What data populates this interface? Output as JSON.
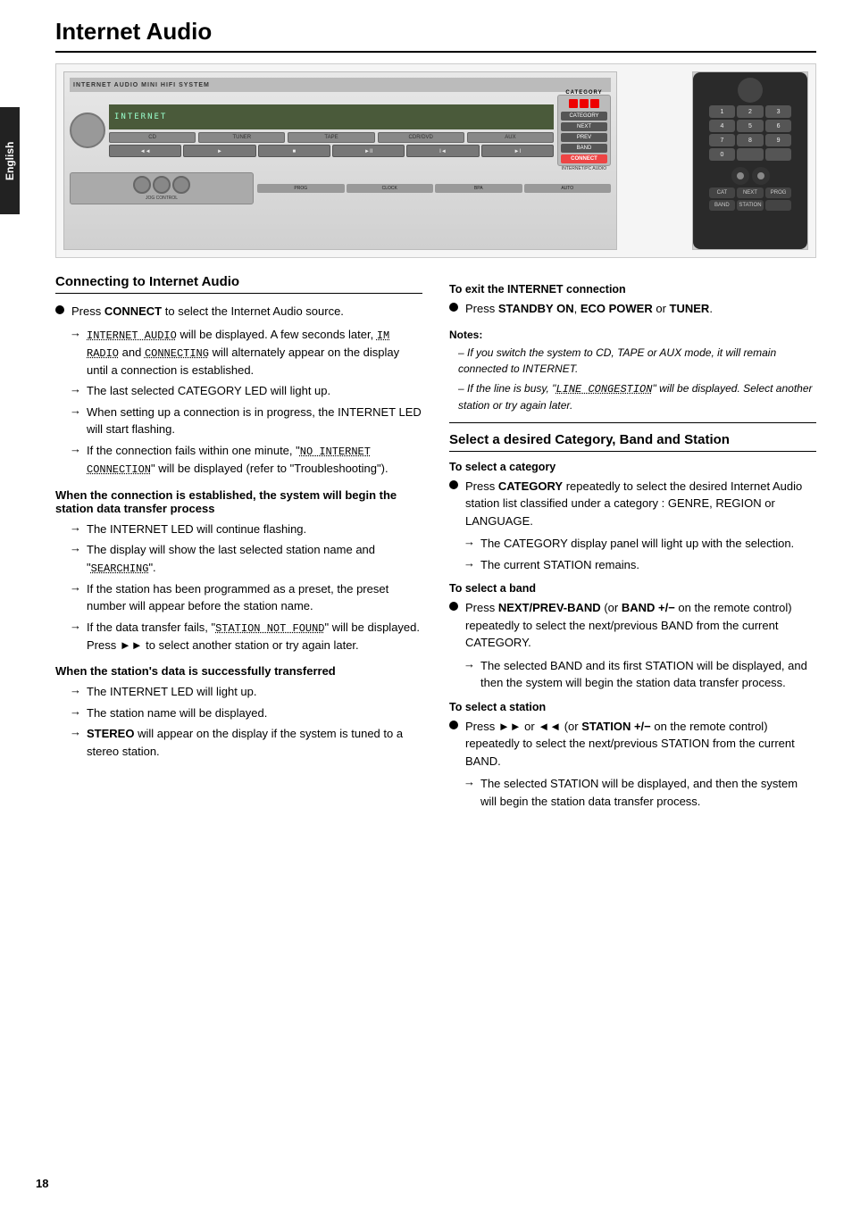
{
  "page": {
    "title": "Internet Audio",
    "number": "18",
    "language_label": "English"
  },
  "device_image": {
    "alt_main": "Internet Audio Mini HiFi System front panel",
    "alt_remote": "Remote control"
  },
  "connecting_section": {
    "heading": "Connecting to Internet Audio",
    "bullet1": {
      "text_before": "Press ",
      "bold": "CONNECT",
      "text_after": " to select the Internet Audio source."
    },
    "arrow1": "\"INTERNET AUDIO\" will be displayed. A few seconds later, \"IM RADIO\" and \"CONNECTING\" will alternately appear on the display until a connection is established.",
    "arrow2": "The last selected CATEGORY LED will light up.",
    "arrow3": "When setting up a connection is in progress, the INTERNET LED will start flashing.",
    "arrow4": "If the connection fails within one minute, \"NO INTERNET CONNECTION\" will be displayed (refer to \"Troubleshooting\").",
    "subhead1": "When the connection is established, the system will begin the station data transfer process",
    "sub_arrow1": "The INTERNET LED will continue flashing.",
    "sub_arrow2": "The display will show the last selected station name and \"SEARCHING\".",
    "sub_arrow3": "If the station has been programmed as a preset, the preset number will appear before the station name.",
    "sub_arrow4": "If the data transfer fails, \"STATION NOT FOUND\" will be displayed. Press ►► to select another station or try again later.",
    "subhead2": "When the station's data is successfully transferred",
    "sub2_arrow1": "The INTERNET LED will light up.",
    "sub2_arrow2": "The station name will be displayed.",
    "sub2_arrow3": "STEREO will appear on the display if the system is tuned to a stereo station."
  },
  "exit_section": {
    "heading": "To exit the INTERNET connection",
    "bullet1_before": "Press ",
    "bullet1_bold1": "STANDBY ON",
    "bullet1_sep": ", ",
    "bullet1_bold2": "ECO POWER",
    "bullet1_or": " or ",
    "bullet1_bold3": "TUNER",
    "bullet1_dot": ".",
    "notes_label": "Notes:",
    "note1": "If you switch the system to CD, TAPE or AUX mode, it will remain connected to INTERNET.",
    "note2": "If the line is busy, \"LINE CONGESTION\" will be displayed. Select another station or try again later."
  },
  "select_section": {
    "heading": "Select a desired Category, Band and Station",
    "category_subhead": "To select a category",
    "category_bullet_before": "Press ",
    "category_bullet_bold": "CATEGORY",
    "category_bullet_after": " repeatedly to select the desired Internet Audio station list classified under a category : GENRE, REGION or LANGUAGE.",
    "category_arrow1": "The CATEGORY display panel will light up with the selection.",
    "category_arrow2": "The current STATION remains.",
    "band_subhead": "To select a band",
    "band_bullet_before": "Press ",
    "band_bullet_bold": "NEXT/PREV-BAND",
    "band_bullet_middle": " (or ",
    "band_bullet_bold2": "BAND +/−",
    "band_bullet_after": " on the remote control) repeatedly to select the next/previous BAND from the current CATEGORY.",
    "band_arrow1": "The selected BAND and its first STATION will be displayed, and then the system will begin the station data transfer process.",
    "station_subhead": "To select a station",
    "station_bullet_before": "Press ►► or ◄◄ (or ",
    "station_bullet_bold": "STATION +/−",
    "station_bullet_after": " on the remote control) repeatedly to select the next/previous STATION from the current BAND.",
    "station_arrow1": "The selected STATION will be displayed, and then the system will begin the station data transfer process."
  },
  "display": {
    "internet_audio": "INTERNET AUDIO",
    "im_radio": "IM RADIO",
    "connecting": "CONNECTING",
    "searching": "SEARCHING",
    "station_not_found": "STATION NOT FOUND",
    "no_internet_connection": "NO INTERNET CONNECTION",
    "line_congestion": "LINE CONGESTION"
  }
}
